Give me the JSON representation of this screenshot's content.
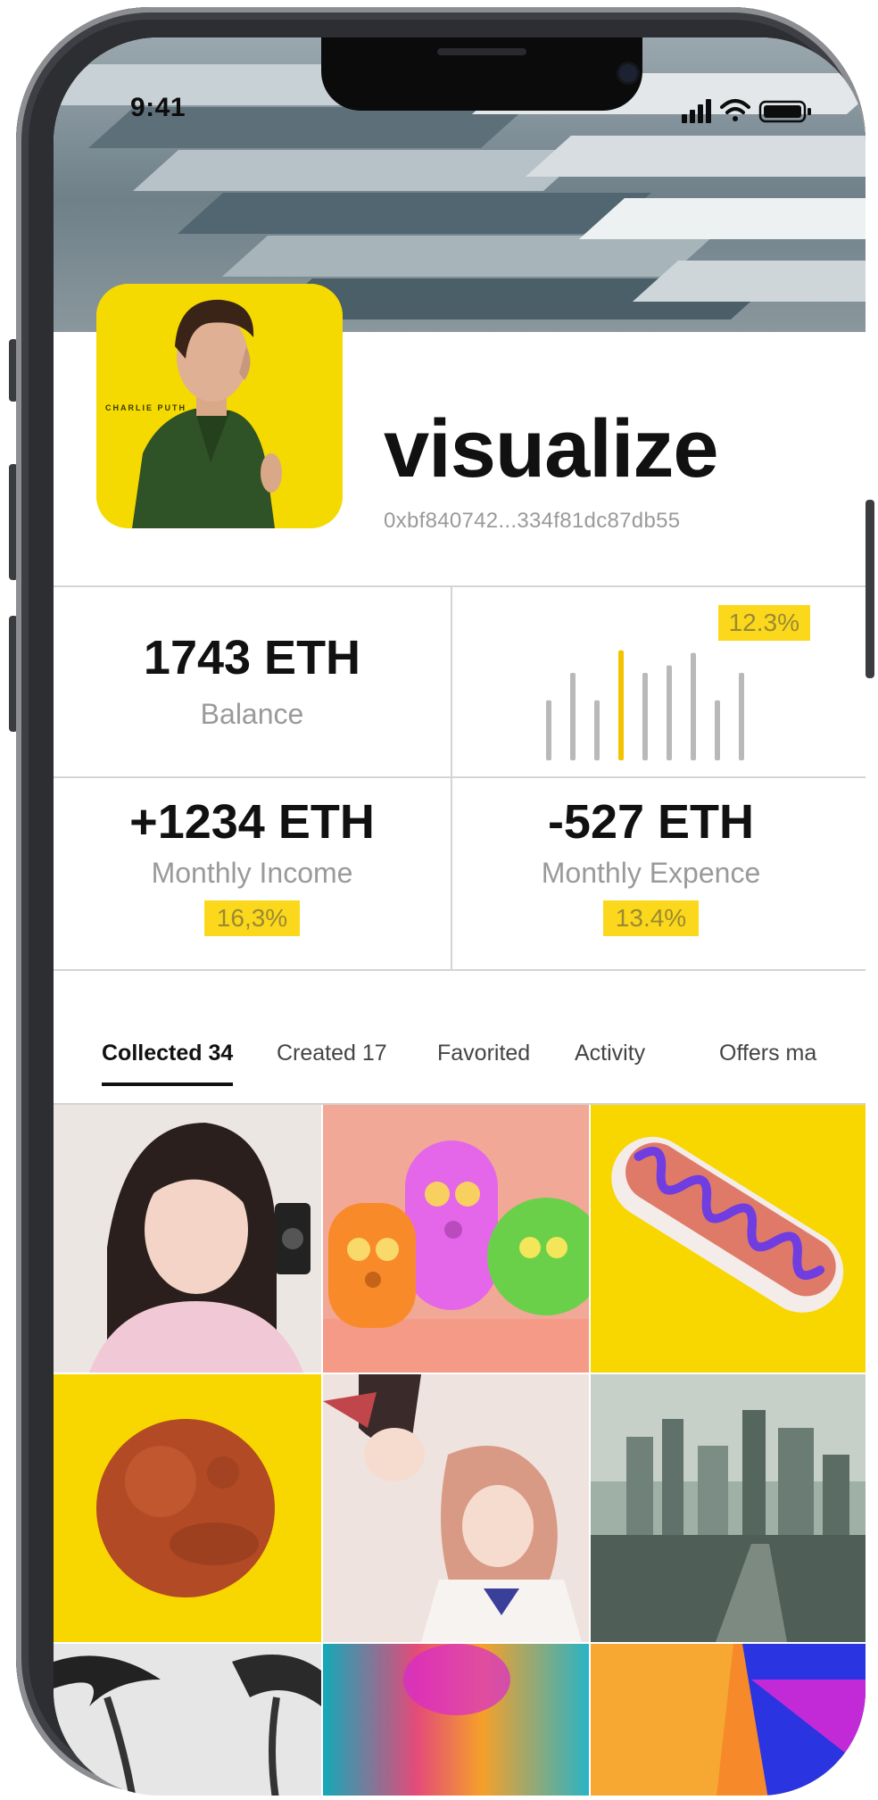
{
  "status_bar": {
    "time": "9:41"
  },
  "profile": {
    "username": "visualize",
    "wallet_address": "0xbf840742...334f81dc87db55",
    "avatar_caption": "CHARLIE PUTH"
  },
  "stats": {
    "balance": {
      "value": "1743 ETH",
      "label": "Balance"
    },
    "chart_change": "12.3%",
    "income": {
      "value": "+1234 ETH",
      "label": "Monthly Income",
      "change": "16,3%"
    },
    "expense": {
      "value": "-527 ETH",
      "label": "Monthly Expence",
      "change": "13.4%"
    }
  },
  "chart_data": {
    "type": "bar",
    "values": [
      48,
      70,
      48,
      88,
      70,
      76,
      86,
      48,
      70
    ],
    "highlight_index": 3,
    "colors": {
      "bar": "#b9b9b9",
      "highlight": "#f2c400"
    }
  },
  "tabs": [
    {
      "label": "Collected 34",
      "active": true
    },
    {
      "label": "Created 17",
      "active": false
    },
    {
      "label": "Favorited",
      "active": false
    },
    {
      "label": "Activity",
      "active": false
    },
    {
      "label": "Offers ma",
      "active": false
    }
  ],
  "colors": {
    "accent": "#fcd81c",
    "accent_text": "#9b8a32",
    "text": "#111111",
    "muted": "#9a9a9a"
  }
}
